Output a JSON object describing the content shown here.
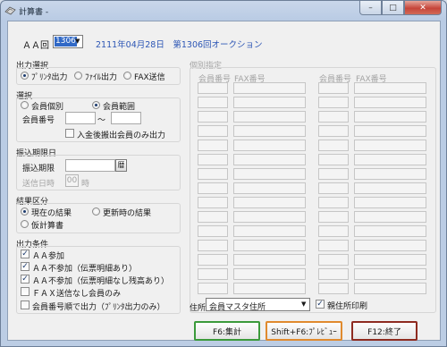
{
  "window": {
    "title": "計算書 -"
  },
  "header": {
    "aa_label": "ＡＡ回",
    "aa_value": "1306",
    "info": "2111年04月28日　第1306回オークション"
  },
  "output_select": {
    "title": "出力選択",
    "options": [
      "ﾌﾟﾘﾝﾀ出力",
      "ﾌｧｲﾙ出力",
      "FAX送信"
    ],
    "selected": 0
  },
  "selection": {
    "title": "選択",
    "options": [
      "会員個別",
      "会員範囲"
    ],
    "selected": 1,
    "member_no_label": "会員番号",
    "tilde": "～",
    "from_value": "",
    "to_value": "",
    "deposit_only_label": "入金後搬出会員のみ出力",
    "deposit_only_checked": false
  },
  "due_date": {
    "title": "振込期限日",
    "deadline_label": "振込期限",
    "deadline_value": "",
    "calendar_label": "暦",
    "send_time_label": "送信日時",
    "send_hour": "00",
    "hour_unit": "時"
  },
  "result_class": {
    "title": "結果区分",
    "options": [
      "現在の結果",
      "更新時の結果",
      "仮計算書"
    ],
    "selected": 0
  },
  "output_cond": {
    "title": "出力条件",
    "items": [
      {
        "label": "ＡＡ参加",
        "checked": true
      },
      {
        "label": "ＡＡ不参加（伝票明細あり）",
        "checked": true
      },
      {
        "label": "ＡＡ不参加（伝票明細なし残高あり）",
        "checked": true
      },
      {
        "label": "ＦＡＸ送信なし会員のみ",
        "checked": false
      },
      {
        "label": "会員番号順で出力（ﾌﾟﾘﾝﾀ出力のみ）",
        "checked": false
      }
    ]
  },
  "individual": {
    "title": "個別指定",
    "col_member": "会員番号",
    "col_fax": "FAX番号",
    "rows": 15
  },
  "address": {
    "label": "住所",
    "value": "会員マスタ住所",
    "parent_print_label": "親住所印刷",
    "parent_print_checked": true
  },
  "buttons": {
    "f6": "F6:集計",
    "shift_f6": "Shift+F6:ﾌﾟﾚﾋﾞｭｰ",
    "f12": "F12:終了"
  },
  "colors": {
    "info_text": "#2d56b5",
    "f6_border": "#3b9a3b",
    "shift_f6_border": "#e08a2e",
    "f12_border": "#8e2b20"
  }
}
